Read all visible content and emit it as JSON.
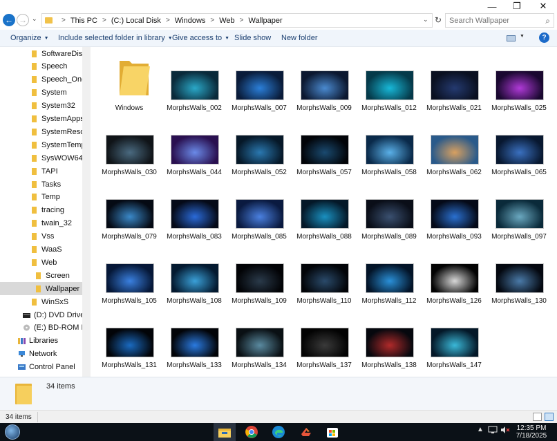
{
  "window": {
    "minimize_glyph": "—",
    "maximize_glyph": "❐",
    "close_glyph": "✕"
  },
  "address": {
    "crumbs": [
      "This PC",
      "(C:) Local Disk",
      "Windows",
      "Web",
      "Wallpaper"
    ],
    "search_placeholder": "Search Wallpaper"
  },
  "toolbar": {
    "organize": "Organize",
    "include_library": "Include selected folder in library",
    "give_access": "Give access to",
    "slide_show": "Slide show",
    "new_folder": "New folder",
    "help": "?"
  },
  "nav": {
    "items": [
      {
        "label": "SoftwareDistri",
        "icon": "folder"
      },
      {
        "label": "Speech",
        "icon": "folder"
      },
      {
        "label": "Speech_OneCo",
        "icon": "folder"
      },
      {
        "label": "System",
        "icon": "folder"
      },
      {
        "label": "System32",
        "icon": "folder"
      },
      {
        "label": "SystemApps",
        "icon": "folder"
      },
      {
        "label": "SystemResour",
        "icon": "folder"
      },
      {
        "label": "SystemTemp",
        "icon": "folder"
      },
      {
        "label": "SysWOW64",
        "icon": "folder"
      },
      {
        "label": "TAPI",
        "icon": "folder"
      },
      {
        "label": "Tasks",
        "icon": "folder"
      },
      {
        "label": "Temp",
        "icon": "folder"
      },
      {
        "label": "tracing",
        "icon": "folder"
      },
      {
        "label": "twain_32",
        "icon": "folder"
      },
      {
        "label": "Vss",
        "icon": "folder"
      },
      {
        "label": "WaaS",
        "icon": "folder"
      },
      {
        "label": "Web",
        "icon": "folder"
      },
      {
        "label": "Screen",
        "icon": "folder"
      },
      {
        "label": "Wallpaper",
        "icon": "folder",
        "selected": true
      },
      {
        "label": "WinSxS",
        "icon": "folder"
      },
      {
        "label": "(D:) DVD Drive -",
        "icon": "dvd-drive"
      },
      {
        "label": "(E:) BD-ROM Driv",
        "icon": "bd-drive"
      },
      {
        "label": "Libraries",
        "icon": "libraries"
      },
      {
        "label": "Network",
        "icon": "network"
      },
      {
        "label": "Control Panel",
        "icon": "control-panel"
      }
    ]
  },
  "files": [
    {
      "name": "Windows",
      "type": "folder"
    },
    {
      "name": "MorphsWalls_002",
      "type": "image",
      "colors": [
        "#0a2a3a",
        "#2aa8c8"
      ]
    },
    {
      "name": "MorphsWalls_007",
      "type": "image",
      "colors": [
        "#0a1c3a",
        "#2b7fd9"
      ]
    },
    {
      "name": "MorphsWalls_009",
      "type": "image",
      "colors": [
        "#0c1830",
        "#4a8ad0"
      ]
    },
    {
      "name": "MorphsWalls_012",
      "type": "image",
      "colors": [
        "#053a4a",
        "#18b8d8"
      ]
    },
    {
      "name": "MorphsWalls_021",
      "type": "image",
      "colors": [
        "#0a1020",
        "#243a70"
      ]
    },
    {
      "name": "MorphsWalls_025",
      "type": "image",
      "colors": [
        "#1a0830",
        "#b03ad8"
      ]
    },
    {
      "name": "MorphsWalls_030",
      "type": "image",
      "colors": [
        "#101418",
        "#4a6a80"
      ]
    },
    {
      "name": "MorphsWalls_044",
      "type": "image",
      "colors": [
        "#2a1050",
        "#6a8ae8"
      ]
    },
    {
      "name": "MorphsWalls_052",
      "type": "image",
      "colors": [
        "#061828",
        "#2a78b0"
      ]
    },
    {
      "name": "MorphsWalls_057",
      "type": "image",
      "colors": [
        "#020408",
        "#1a4a70"
      ]
    },
    {
      "name": "MorphsWalls_058",
      "type": "image",
      "colors": [
        "#0a2a4a",
        "#5ab0e8"
      ]
    },
    {
      "name": "MorphsWalls_062",
      "type": "image",
      "colors": [
        "#2a5a8a",
        "#d8a060"
      ]
    },
    {
      "name": "MorphsWalls_065",
      "type": "image",
      "colors": [
        "#081830",
        "#3a70c0"
      ]
    },
    {
      "name": "MorphsWalls_079",
      "type": "image",
      "colors": [
        "#050a14",
        "#3a88c8"
      ]
    },
    {
      "name": "MorphsWalls_083",
      "type": "image",
      "colors": [
        "#050a18",
        "#2a6ad8"
      ]
    },
    {
      "name": "MorphsWalls_085",
      "type": "image",
      "colors": [
        "#0a1a40",
        "#4a80e0"
      ]
    },
    {
      "name": "MorphsWalls_088",
      "type": "image",
      "colors": [
        "#041828",
        "#1a90c0"
      ]
    },
    {
      "name": "MorphsWalls_089",
      "type": "image",
      "colors": [
        "#0a0e18",
        "#3a5070"
      ]
    },
    {
      "name": "MorphsWalls_093",
      "type": "image",
      "colors": [
        "#050a18",
        "#2a70d0"
      ]
    },
    {
      "name": "MorphsWalls_097",
      "type": "image",
      "colors": [
        "#0a2a3a",
        "#6aa8c0"
      ]
    },
    {
      "name": "MorphsWalls_105",
      "type": "image",
      "colors": [
        "#061838",
        "#3a80e0"
      ]
    },
    {
      "name": "MorphsWalls_108",
      "type": "image",
      "colors": [
        "#041a30",
        "#3aa0d8"
      ]
    },
    {
      "name": "MorphsWalls_109",
      "type": "image",
      "colors": [
        "#020306",
        "#2a3a4a"
      ]
    },
    {
      "name": "MorphsWalls_110",
      "type": "image",
      "colors": [
        "#020408",
        "#2a4a6a"
      ]
    },
    {
      "name": "MorphsWalls_112",
      "type": "image",
      "colors": [
        "#031428",
        "#2a90d8"
      ]
    },
    {
      "name": "MorphsWalls_126",
      "type": "image",
      "colors": [
        "#030303",
        "#d8d8d8"
      ]
    },
    {
      "name": "MorphsWalls_130",
      "type": "image",
      "colors": [
        "#040810",
        "#4a7aa8"
      ]
    },
    {
      "name": "MorphsWalls_131",
      "type": "image",
      "colors": [
        "#020408",
        "#1a6ac0"
      ]
    },
    {
      "name": "MorphsWalls_133",
      "type": "image",
      "colors": [
        "#020408",
        "#2a7ae0"
      ]
    },
    {
      "name": "MorphsWalls_134",
      "type": "image",
      "colors": [
        "#0a1014",
        "#5a8aa0"
      ]
    },
    {
      "name": "MorphsWalls_137",
      "type": "image",
      "colors": [
        "#030303",
        "#3a3a3a"
      ]
    },
    {
      "name": "MorphsWalls_138",
      "type": "image",
      "colors": [
        "#06080e",
        "#b02a2a"
      ]
    },
    {
      "name": "MorphsWalls_147",
      "type": "image",
      "colors": [
        "#041828",
        "#3ab8d8"
      ]
    }
  ],
  "details": {
    "item_count": "34 items"
  },
  "status": {
    "item_count": "34 items"
  },
  "taskbar": {
    "apps": [
      "file-explorer",
      "chrome",
      "edge",
      "git",
      "microsoft-store"
    ],
    "tray_caret": "▲",
    "time": "12:35 PM",
    "date": "7/18/2025"
  }
}
